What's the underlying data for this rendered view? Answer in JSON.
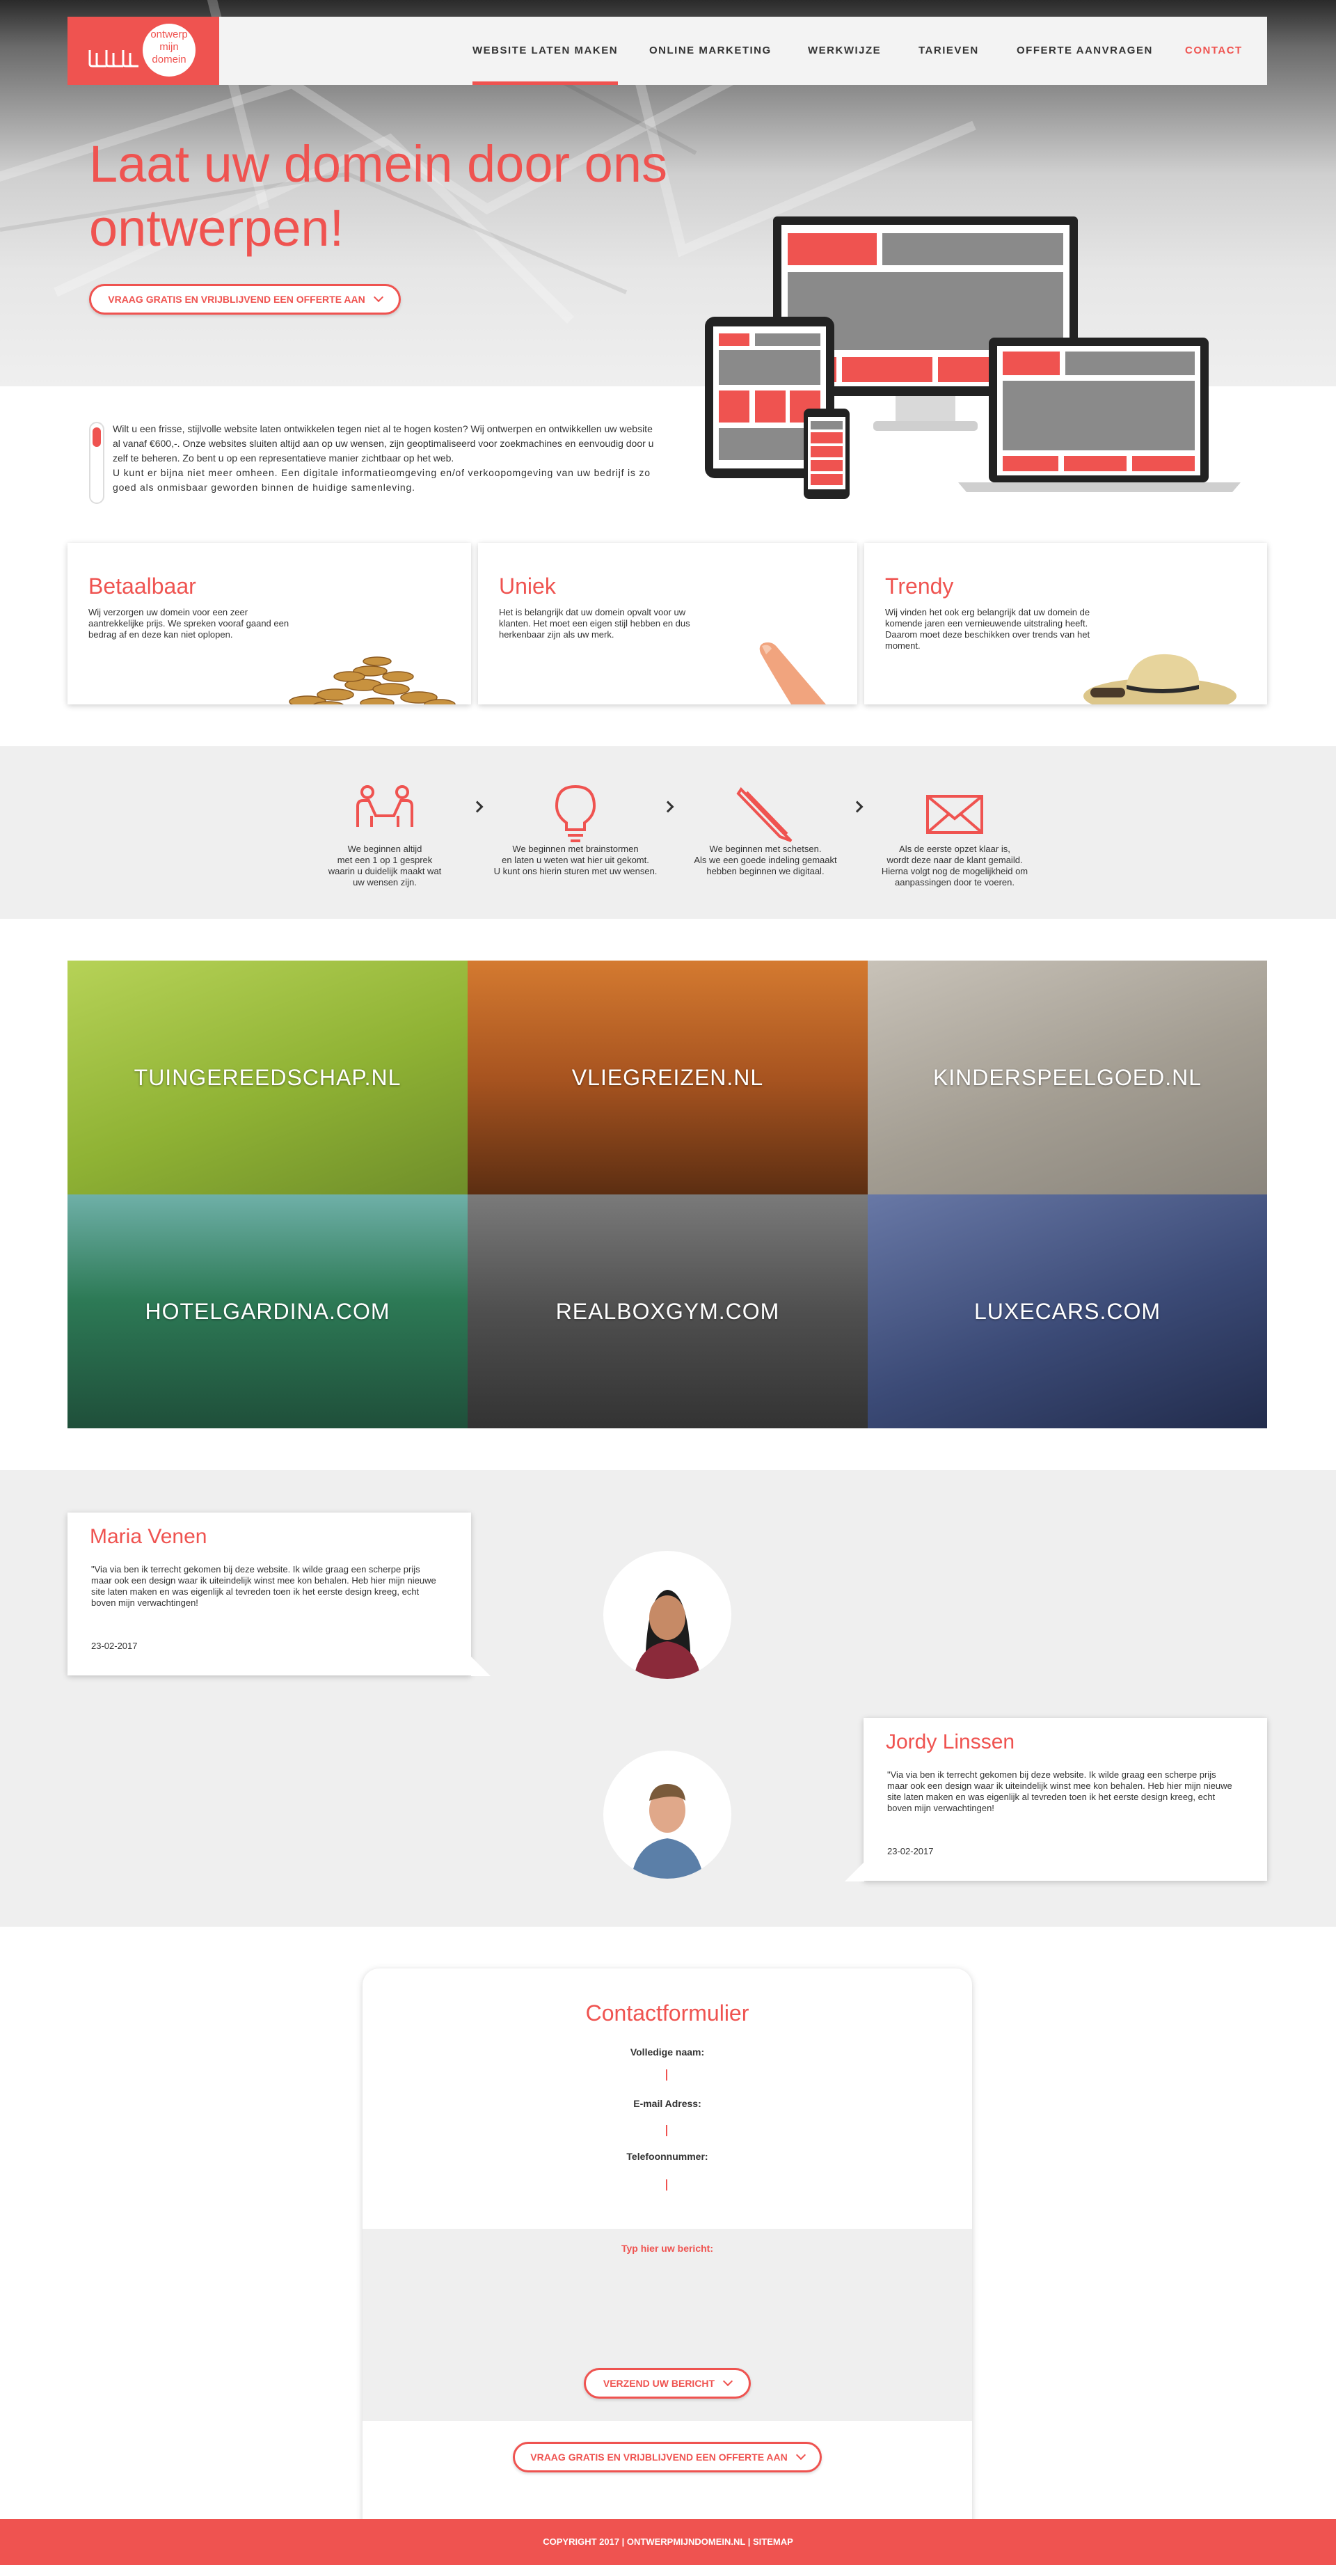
{
  "brand": {
    "logo_lines": [
      "ontwerp",
      "mijn",
      "domein"
    ],
    "accent": "#ef5350"
  },
  "nav": {
    "items": [
      "WEBSITE LATEN MAKEN",
      "ONLINE MARKETING",
      "WERKWIJZE",
      "TARIEVEN",
      "OFFERTE AANVRAGEN",
      "CONTACT"
    ],
    "active": "WEBSITE LATEN MAKEN"
  },
  "hero": {
    "title_line1": "Laat uw domein door ons",
    "title_line2": "ontwerpen!",
    "cta": "VRAAG GRATIS EN VRIJBLIJVEND EEN OFFERTE AAN"
  },
  "intro": {
    "para1": "Wilt u een frisse, stijlvolle website laten ontwikkelen tegen niet al te hogen kosten? Wij ontwerpen en ontwikkellen uw website al vanaf €600,-. Onze websites sluiten altijd aan op uw wensen, zijn geoptimaliseerd voor zoekmachines en eenvoudig door u zelf te beheren. Zo bent u op een representatieve manier zichtbaar op het web.",
    "para2": "U kunt er bijna niet meer omheen. Een digitale informatieomgeving en/of verkoopomgeving van uw bedrijf is zo goed als onmisbaar geworden binnen de huidige samenleving."
  },
  "cards": [
    {
      "title": "Betaalbaar",
      "text": "Wij verzorgen uw domein voor een zeer aantrekkelijke prijs. We spreken vooraf gaand een bedrag af en deze kan niet oplopen."
    },
    {
      "title": "Uniek",
      "text": "Het is belangrijk dat uw domein opvalt voor uw klanten. Het moet een eigen stijl hebben en dus herkenbaar zijn als uw merk."
    },
    {
      "title": "Trendy",
      "text": "Wij vinden het ook erg belangrijk dat uw domein de komende jaren een vernieuwende uitstraling heeft. Daarom moet deze beschikken over trends van het moment."
    }
  ],
  "process": [
    {
      "icon": "meeting-icon",
      "text_lines": [
        "We beginnen altijd",
        "met een 1 op 1 gesprek",
        "waarin u duidelijk maakt wat",
        "uw wensen zijn."
      ]
    },
    {
      "icon": "lightbulb-icon",
      "text_lines": [
        "We beginnen met brainstormen",
        "en laten u weten wat hier uit gekomt.",
        "U kunt ons hierin sturen met uw wensen."
      ]
    },
    {
      "icon": "pencil-icon",
      "text_lines": [
        "We beginnen met schetsen.",
        "Als we een goede indeling gemaakt",
        "hebben beginnen we digitaal."
      ]
    },
    {
      "icon": "envelope-icon",
      "text_lines": [
        "Als de eerste opzet klaar is,",
        "wordt deze naar de klant gemaild.",
        "Hierna volgt nog de mogelijkheid om",
        "aanpassingen door te voeren."
      ]
    }
  ],
  "portfolio": [
    {
      "label": "TUINGEREEDSCHAP.NL",
      "color": "#9cbf3a"
    },
    {
      "label": "VLIEGREIZEN.NL",
      "color": "#a45a22"
    },
    {
      "label": "KINDERSPEELGOED.NL",
      "color": "#a49e93"
    },
    {
      "label": "HOTELGARDINA.COM",
      "color": "#2d7a56"
    },
    {
      "label": "REALBOXGYM.COM",
      "color": "#5a5a5a"
    },
    {
      "label": "LUXECARS.COM",
      "color": "#3b4a76"
    }
  ],
  "testimonials": [
    {
      "name": "Maria Venen",
      "quote": "\"Via via ben ik terrecht gekomen bij deze website. Ik wilde graag een scherpe prijs maar ook een design waar ik uiteindelijk winst mee kon behalen. Heb hier mijn nieuwe site laten maken en was eigenlijk al tevreden toen ik het eerste design kreeg, echt boven mijn verwachtingen!",
      "date": "23-02-2017"
    },
    {
      "name": "Jordy Linssen",
      "quote": "\"Via via ben ik terrecht gekomen bij deze website. Ik wilde graag een scherpe prijs maar ook een design waar ik uiteindelijk winst mee kon behalen. Heb hier mijn nieuwe site laten maken en was eigenlijk al tevreden toen ik het eerste design kreeg, echt boven mijn verwachtingen!",
      "date": "23-02-2017"
    }
  ],
  "contact": {
    "title": "Contactformulier",
    "name_label": "Volledige naam:",
    "email_label": "E-mail Adress:",
    "phone_label": "Telefoonnummer:",
    "message_placeholder": "Typ hier uw bericht:",
    "submit": "VERZEND UW BERICHT",
    "cta": "VRAAG GRATIS EN VRIJBLIJVEND EEN OFFERTE AAN"
  },
  "footer": {
    "text": "COPYRIGHT 2017 | ONTWERPMIJNDOMEIN.NL | SITEMAP"
  }
}
